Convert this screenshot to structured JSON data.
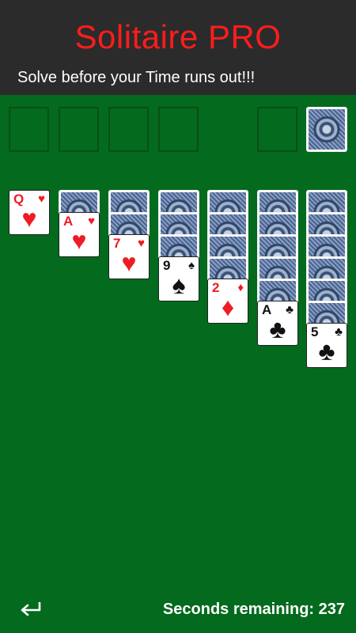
{
  "header": {
    "title": "Solitaire PRO",
    "subtitle": "Solve before your Time runs out!!!"
  },
  "foundations": [
    "empty",
    "empty",
    "empty",
    "empty"
  ],
  "waste": "empty",
  "stock": "face-down",
  "tableau": [
    {
      "hidden": 0,
      "face_up": [
        {
          "rank": "Q",
          "suit": "♥",
          "color": "red"
        }
      ]
    },
    {
      "hidden": 1,
      "face_up": [
        {
          "rank": "A",
          "suit": "♥",
          "color": "red"
        }
      ]
    },
    {
      "hidden": 2,
      "face_up": [
        {
          "rank": "7",
          "suit": "♥",
          "color": "red"
        }
      ]
    },
    {
      "hidden": 3,
      "face_up": [
        {
          "rank": "9",
          "suit": "♠",
          "color": "black"
        }
      ]
    },
    {
      "hidden": 4,
      "face_up": [
        {
          "rank": "2",
          "suit": "♦",
          "color": "red"
        }
      ]
    },
    {
      "hidden": 5,
      "face_up": [
        {
          "rank": "A",
          "suit": "♣",
          "color": "black"
        }
      ]
    },
    {
      "hidden": 6,
      "face_up": [
        {
          "rank": "5",
          "suit": "♣",
          "color": "black"
        }
      ]
    }
  ],
  "footer": {
    "back_icon": "return-arrow-icon",
    "timer_text": "Seconds remaining: 237",
    "seconds_remaining": 237
  },
  "colors": {
    "header_bg": "#2b2b2b",
    "title_color": "#ff1c1c",
    "felt_green": "#046a1e",
    "red_suit": "#ee1c24",
    "black_suit": "#111111"
  }
}
